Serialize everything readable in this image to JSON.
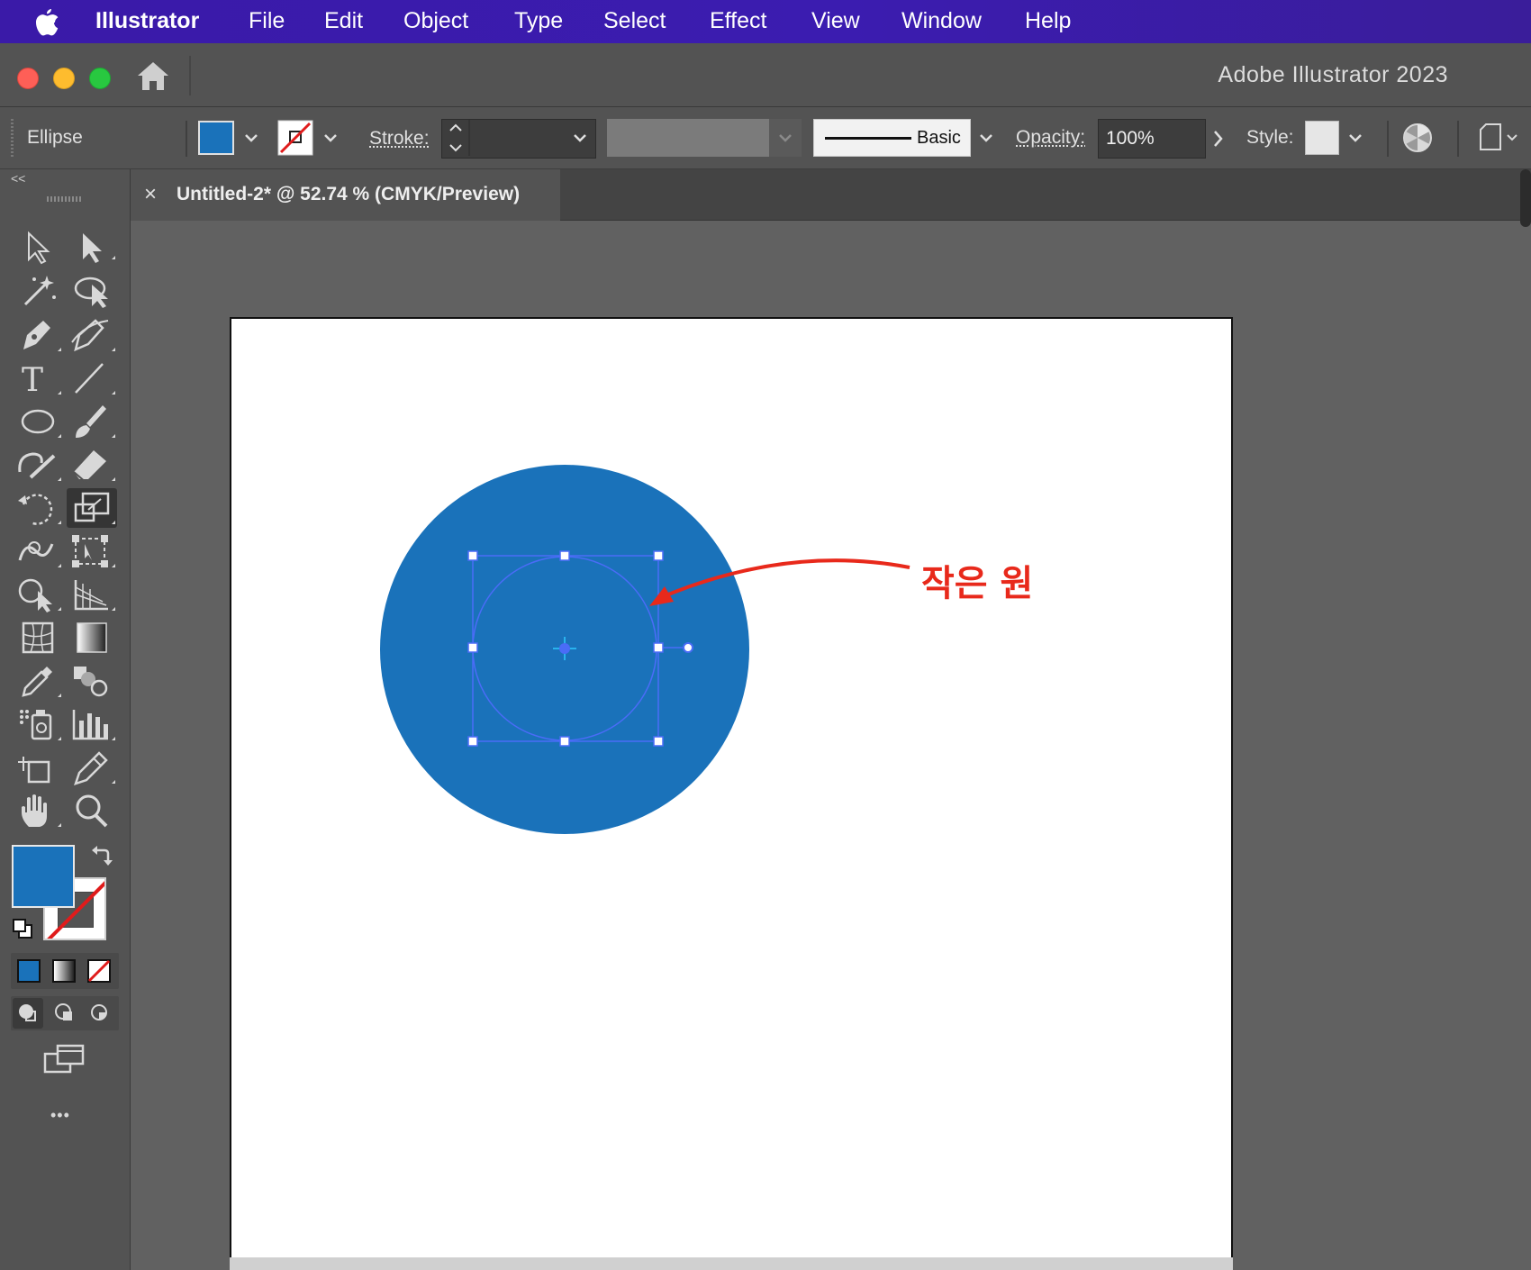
{
  "menubar": {
    "apple_icon": "apple-icon",
    "app": "Illustrator",
    "items": [
      "File",
      "Edit",
      "Object",
      "Type",
      "Select",
      "Effect",
      "View",
      "Window",
      "Help"
    ]
  },
  "titlebar": {
    "title": "Adobe Illustrator 2023",
    "home_icon": "home-icon"
  },
  "controlbar": {
    "selection_label": "Ellipse",
    "stroke_label": "Stroke:",
    "stroke_value": "",
    "brush_label": "Basic",
    "opacity_label": "Opacity:",
    "opacity_value": "100%",
    "style_label": "Style:"
  },
  "document": {
    "tab_close": "×",
    "tab_title": "Untitled-2* @ 52.74 % (CMYK/Preview)"
  },
  "toolbar": {
    "collapse_label": "<<",
    "more_label": "•••",
    "tools": [
      "selection-tool",
      "direct-selection-tool",
      "magic-wand-tool",
      "lasso-tool",
      "pen-tool",
      "curvature-tool",
      "type-tool",
      "line-segment-tool",
      "ellipse-tool",
      "paintbrush-tool",
      "shaper-tool",
      "eraser-tool",
      "rotate-tool",
      "scale-tool",
      "warp-tool",
      "free-transform-tool",
      "shape-builder-tool",
      "perspective-grid-tool",
      "mesh-tool",
      "gradient-tool",
      "eyedropper-tool",
      "blend-tool",
      "symbol-sprayer-tool",
      "column-graph-tool",
      "artboard-tool",
      "slice-tool",
      "hand-tool",
      "zoom-tool"
    ]
  },
  "colors": {
    "fill": "#1a72ba",
    "menubar": "#3b1cb0",
    "annotation": "#e8291b",
    "selection": "#4a6cf7"
  },
  "canvas": {
    "annotation_text": "작은 원"
  }
}
